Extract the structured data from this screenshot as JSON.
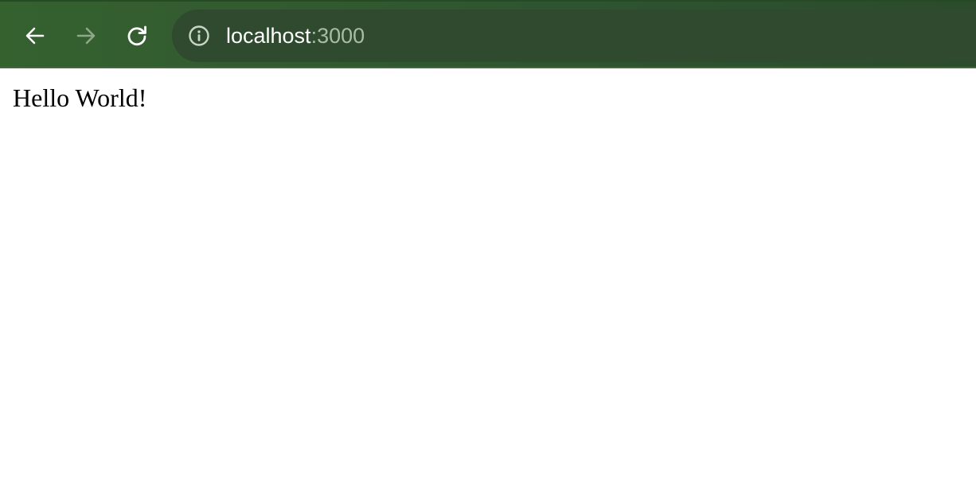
{
  "browser": {
    "toolbar_color": "#2f5530",
    "omnibox_color": "#2f4a2e",
    "nav": {
      "back_icon": "arrow-left-icon",
      "back_enabled": true,
      "forward_icon": "arrow-right-icon",
      "forward_enabled": false,
      "reload_icon": "reload-icon"
    },
    "address_bar": {
      "security_icon": "info-icon",
      "host": "localhost",
      "port": ":3000"
    }
  },
  "page": {
    "text": "Hello World!"
  }
}
